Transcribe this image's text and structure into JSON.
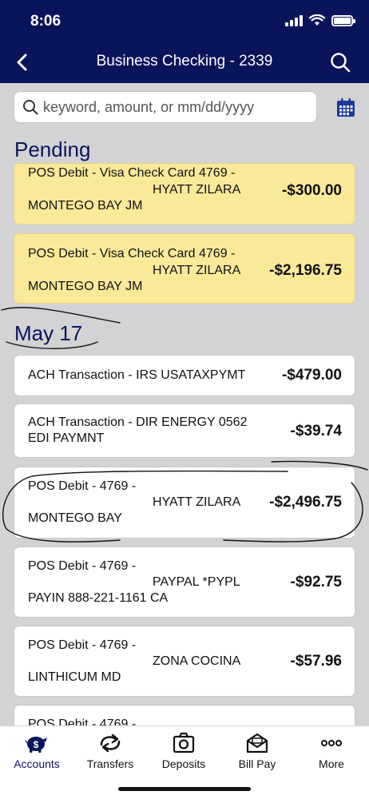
{
  "status_bar": {
    "time": "8:06"
  },
  "nav": {
    "title": "Business Checking - 2339"
  },
  "search": {
    "placeholder": "keyword, amount, or mm/dd/yyyy"
  },
  "sections": {
    "pending": {
      "title": "Pending",
      "items": [
        {
          "line1": "POS Debit - Visa Check Card 4769 -",
          "line2": "HYATT ZILARA",
          "line3": "MONTEGO BAY JM",
          "amount": "-$300.00"
        },
        {
          "line1": "POS Debit - Visa Check Card 4769 -",
          "line2": "HYATT ZILARA",
          "line3": "MONTEGO BAY JM",
          "amount": "-$2,196.75"
        }
      ]
    },
    "may17": {
      "title": "May 17",
      "items": [
        {
          "line1": "ACH Transaction - IRS USATAXPYMT",
          "amount": "-$479.00"
        },
        {
          "line1": "ACH Transaction - DIR ENERGY 0562",
          "line2": "EDI PAYMNT",
          "amount": "-$39.74"
        },
        {
          "line1": "POS Debit - 4769 -",
          "line2": "HYATT ZILARA",
          "line3": "MONTEGO BAY",
          "amount": "-$2,496.75"
        },
        {
          "line1": "POS Debit - 4769 -",
          "line2": "PAYPAL *PYPL",
          "line3": "PAYIN 888-221-1161 CA",
          "amount": "-$92.75"
        },
        {
          "line1": "POS Debit - 4769 -",
          "line2": "ZONA COCINA",
          "line3": "LINTHICUM MD",
          "amount": "-$57.96"
        },
        {
          "line1": "POS Debit - 4769 -"
        }
      ]
    }
  },
  "tabs": [
    {
      "label": "Accounts",
      "icon": "piggy-bank-icon"
    },
    {
      "label": "Transfers",
      "icon": "transfer-arrows-icon"
    },
    {
      "label": "Deposits",
      "icon": "camera-icon"
    },
    {
      "label": "Bill Pay",
      "icon": "envelope-open-icon"
    },
    {
      "label": "More",
      "icon": "more-dots-icon"
    }
  ],
  "colors": {
    "brand_navy": "#0a145a",
    "pending_yellow": "#fbe99a",
    "background": "#d3d3d6"
  }
}
